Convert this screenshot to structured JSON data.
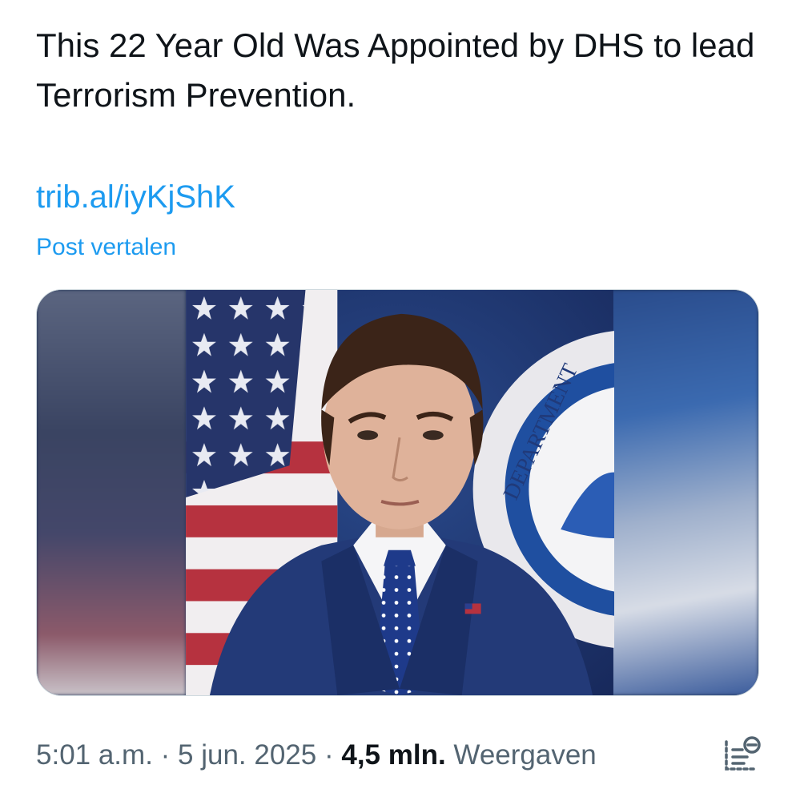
{
  "post": {
    "text": "This 22 Year Old Was Appointed by DHS to lead Terrorism Prevention.",
    "link_text": "trib.al/iyKjShK",
    "translate_label": "Post vertalen"
  },
  "media": {
    "seal_text": "DEPARTMENT",
    "alt": "photo-of-man-in-suit"
  },
  "meta": {
    "time": "5:01 a.m.",
    "separator1": " · ",
    "date": "5 jun. 2025",
    "separator2": " · ",
    "views_count": "4,5 mln.",
    "views_label": " Weergaven"
  },
  "icons": {
    "analytics": "view-analytics-icon"
  },
  "colors": {
    "link": "#1d9bf0",
    "text": "#0f1419",
    "muted": "#536471",
    "border": "#cfd9de"
  }
}
